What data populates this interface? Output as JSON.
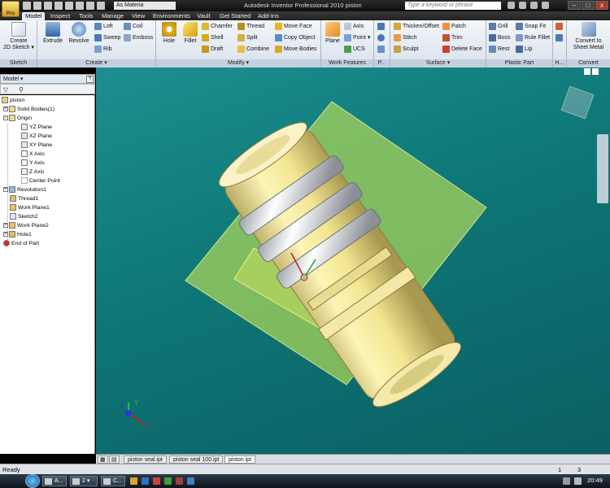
{
  "titlebar": {
    "app_menu": "Pro",
    "material": "As Materia",
    "title": "Autodesk Inventor Professional 2010    piston",
    "search_placeholder": "Type a keyword or phrase",
    "win_min": "–",
    "win_max": "□",
    "win_close": "x"
  },
  "tabs": [
    "Model",
    "Inspect",
    "Tools",
    "Manage",
    "View",
    "Environments",
    "Vault",
    "Get Started",
    "Add-Ins"
  ],
  "active_tab": "Model",
  "ribbon": {
    "sketch": {
      "title": "Sketch",
      "create_2d": "Create",
      "create_2d_2": "2D Sketch ▾"
    },
    "create": {
      "title": "Create ▾",
      "extrude": "Extrude",
      "revolve": "Revolve",
      "loft": "Loft",
      "sweep": "Sweep",
      "rib": "Rib",
      "coil": "Coil",
      "emboss": "Emboss"
    },
    "modify": {
      "title": "Modify ▾",
      "hole": "Hole",
      "fillet": "Fillet",
      "chamfer": "Chamfer",
      "shell": "Shell",
      "draft": "Draft",
      "thread": "Thread",
      "split": "Split",
      "combine": "Combine",
      "move_face": "Move Face",
      "copy_object": "Copy Object",
      "move_bodies": "Move Bodies"
    },
    "work_features": {
      "title": "Work Features",
      "plane": "Plane",
      "axis": "Axis",
      "point": "Point ▾",
      "ucs": "UCS"
    },
    "pattern": {
      "title": "P..."
    },
    "surface": {
      "title": "Surface ▾",
      "thicken": "Thicken/Offset",
      "stitch": "Stitch",
      "sculpt": "Sculpt",
      "patch": "Patch",
      "trim": "Trim",
      "delete_face": "Delete Face"
    },
    "plastic": {
      "title": "Plastic Part",
      "grill": "Grill",
      "boss": "Boss",
      "rest": "Rest",
      "snap_fit": "Snap Fit",
      "rule_fillet": "Rule Fillet",
      "lip": "Lip"
    },
    "harness": {
      "title": "H..."
    },
    "convert": {
      "title": "Convert",
      "label1": "Convert to",
      "label2": "Sheet Metal"
    }
  },
  "browser": {
    "header": "Model ▾",
    "close": "?",
    "filter_icon": "▽",
    "find_icon": "⚲",
    "tree": [
      {
        "label": "piston",
        "indent": 0,
        "icon": "part"
      },
      {
        "label": "Solid Bodies(1)",
        "indent": 1,
        "icon": "folder"
      },
      {
        "label": "Origin",
        "indent": 1,
        "icon": "folder"
      },
      {
        "label": "YZ Plane",
        "indent": 2,
        "icon": "plane"
      },
      {
        "label": "XZ Plane",
        "indent": 2,
        "icon": "plane"
      },
      {
        "label": "XY Plane",
        "indent": 2,
        "icon": "plane"
      },
      {
        "label": "X Axis",
        "indent": 2,
        "icon": "axis"
      },
      {
        "label": "Y Axis",
        "indent": 2,
        "icon": "axis"
      },
      {
        "label": "Z Axis",
        "indent": 2,
        "icon": "axis"
      },
      {
        "label": "Center Point",
        "indent": 2,
        "icon": "point"
      },
      {
        "label": "Revolution1",
        "indent": 1,
        "icon": "feature"
      },
      {
        "label": "Thread1",
        "indent": 1,
        "icon": "feature"
      },
      {
        "label": "Work Plane1",
        "indent": 1,
        "icon": "plane"
      },
      {
        "label": "Sketch2",
        "indent": 1,
        "icon": "sketch"
      },
      {
        "label": "Work Plane2",
        "indent": 1,
        "icon": "plane"
      },
      {
        "label": "Hole1",
        "indent": 1,
        "icon": "feature"
      },
      {
        "label": "End of Part",
        "indent": 1,
        "icon": "end"
      }
    ]
  },
  "doc_tabs": [
    "piston seal.ipt",
    "piston seal 100.ipt",
    "piston.ipt"
  ],
  "active_doc": "piston.ipt",
  "axes": {
    "x": "X",
    "y": "Y",
    "z": "Z"
  },
  "status": {
    "text": "Ready",
    "count1": "1",
    "count2": "3"
  },
  "taskbar": {
    "buttons": [
      "A...",
      "2 ▾",
      "C..."
    ],
    "clock": "20:49"
  }
}
